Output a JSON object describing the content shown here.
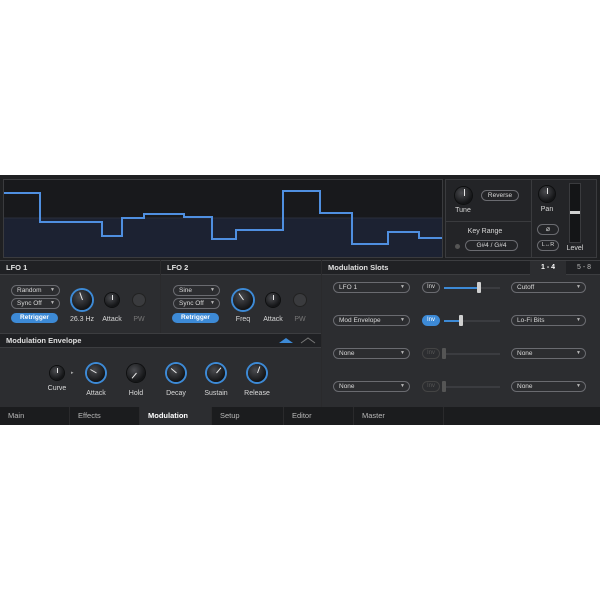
{
  "top": {
    "tune_label": "Tune",
    "reverse_label": "Reverse",
    "key_range_label": "Key Range",
    "key_range_value": "G#4  /  G#4",
    "pan_label": "Pan",
    "phase_icon": "⌀",
    "lr_label": "L↔R",
    "level_label": "Level"
  },
  "lfo1": {
    "title": "LFO 1",
    "wave": "Random",
    "sync": "Sync Off",
    "retrigger": "Retrigger",
    "rate": "26.3 Hz",
    "attack": "Attack",
    "pw": "PW"
  },
  "lfo2": {
    "title": "LFO 2",
    "wave": "Sine",
    "sync": "Sync Off",
    "retrigger": "Retrigger",
    "freq": "Freq",
    "attack": "Attack",
    "pw": "PW"
  },
  "env": {
    "title": "Modulation Envelope",
    "curve": "Curve",
    "attack": "Attack",
    "hold": "Hold",
    "decay": "Decay",
    "sustain": "Sustain",
    "release": "Release"
  },
  "slots": {
    "title": "Modulation Slots",
    "page_a": "1 - 4",
    "page_b": "5 - 8",
    "rows": [
      {
        "source": "LFO 1",
        "inv": "Inv",
        "target": "Cutoff",
        "amount": 0.62
      },
      {
        "source": "Mod Envelope",
        "inv": "Inv",
        "target": "Lo-Fi Bits",
        "amount": 0.3
      },
      {
        "source": "None",
        "inv": "Inv",
        "target": "None",
        "amount": 0
      },
      {
        "source": "None",
        "inv": "Inv",
        "target": "None",
        "amount": 0
      }
    ]
  },
  "tabs": [
    "Main",
    "Effects",
    "Modulation",
    "Setup",
    "Editor",
    "Master"
  ],
  "active_tab": "Modulation",
  "colors": {
    "accent": "#3d8ad6",
    "background": "#2a2a2c",
    "waveform": "#4f8fe0"
  }
}
